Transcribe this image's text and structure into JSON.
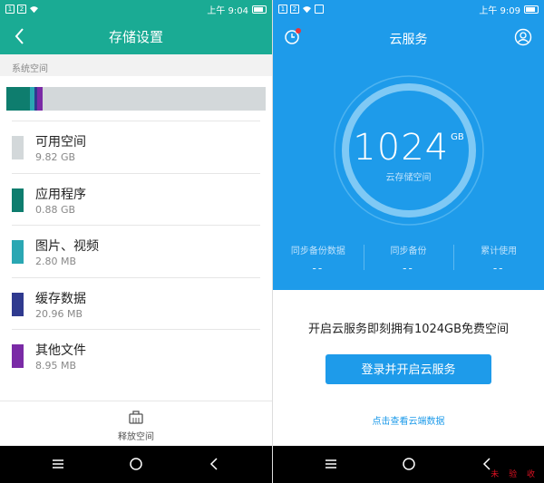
{
  "left": {
    "status": {
      "sim1": "1",
      "sim2": "2",
      "time": "上午 9:04"
    },
    "header": {
      "title": "存储设置"
    },
    "section_label": "系统空间",
    "usage_segments": [
      {
        "name": "应用程序",
        "fraction": 0.09,
        "color": "#0e7d6e"
      },
      {
        "name": "图片、视频",
        "fraction": 0.02,
        "color": "#2aa7b3"
      },
      {
        "name": "缓存数据",
        "fraction": 0.01,
        "color": "#2f3a8f"
      },
      {
        "name": "其他文件",
        "fraction": 0.02,
        "color": "#7a2aa6"
      }
    ],
    "items": [
      {
        "name": "可用空间",
        "size": "9.82 GB",
        "color": "#d3d8da"
      },
      {
        "name": "应用程序",
        "size": "0.88 GB",
        "color": "#0e7d6e"
      },
      {
        "name": "图片、视频",
        "size": "2.80 MB",
        "color": "#2aa7b3"
      },
      {
        "name": "缓存数据",
        "size": "20.96 MB",
        "color": "#2f3a8f"
      },
      {
        "name": "其他文件",
        "size": "8.95 MB",
        "color": "#7a2aa6"
      }
    ],
    "release_label": "释放空间"
  },
  "right": {
    "status": {
      "sim1": "1",
      "sim2": "2",
      "time": "上午 9:09"
    },
    "header": {
      "title": "云服务"
    },
    "capacity": {
      "value": "1024",
      "unit": "GB",
      "caption": "云存储空间"
    },
    "stats": [
      {
        "label": "同步备份数据",
        "value": "--"
      },
      {
        "label": "同步备份",
        "value": "--"
      },
      {
        "label": "累计使用",
        "value": "--"
      }
    ],
    "promo": "开启云服务即刻拥有1024GB免费空间",
    "cta": "登录并开启云服务",
    "link": "点击查看云端数据"
  },
  "watermark": "未 验 收",
  "colors": {
    "teal": "#1aab94",
    "blue": "#1e9bea"
  }
}
